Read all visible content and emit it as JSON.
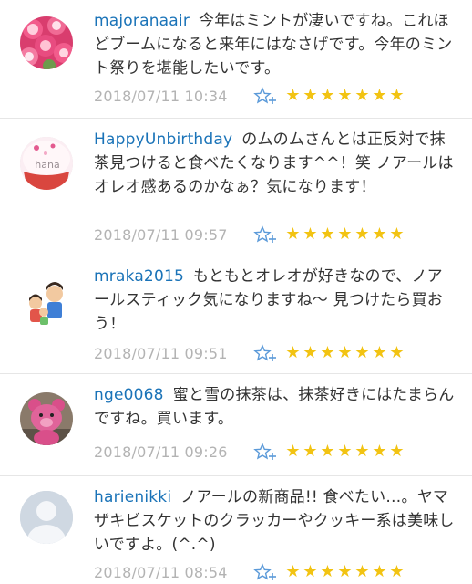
{
  "comments": [
    {
      "username": "majoranaair",
      "text": "今年はミントが凄いですね。これほどブームになると来年にはなさげです。今年のミント祭りを堪能したいです。",
      "timestamp": "2018/07/11 10:34",
      "avatar": "pink-roses",
      "favorite_icon": "star-plus-icon",
      "stars": [
        "★",
        "★",
        "★",
        "★",
        "★",
        "★",
        "★"
      ]
    },
    {
      "username": "HappyUnbirthday",
      "text": "のムのムさんとは正反対で抹茶見つけると食べたくなります^^！笑 ノアールはオレオ感あるのかなぁ？気になります！",
      "timestamp": "2018/07/11 09:57",
      "avatar": "cupcake-hana",
      "avatar_label": "hana",
      "favorite_icon": "star-plus-icon",
      "stars": [
        "★",
        "★",
        "★",
        "★",
        "★",
        "★",
        "★"
      ]
    },
    {
      "username": "mraka2015",
      "text": "もともとオレオが好きなので、ノアールスティック気になりますね〜 見つけたら買おう！",
      "timestamp": "2018/07/11 09:51",
      "avatar": "cartoon-family",
      "favorite_icon": "star-plus-icon",
      "stars": [
        "★",
        "★",
        "★",
        "★",
        "★",
        "★",
        "★"
      ]
    },
    {
      "username": "nge0068",
      "text": "蜜と雪の抹茶は、抹茶好きにはたまらんですね。買います。",
      "timestamp": "2018/07/11 09:26",
      "avatar": "pink-bear-toy",
      "favorite_icon": "star-plus-icon",
      "stars": [
        "★",
        "★",
        "★",
        "★",
        "★",
        "★",
        "★"
      ]
    },
    {
      "username": "harienikki",
      "text": "ノアールの新商品!! 食べたい…。ヤマザキビスケットのクラッカーやクッキー系は美味しいですよ。(^.^)",
      "timestamp": "2018/07/11 08:54",
      "avatar": "default-user",
      "favorite_icon": "star-plus-icon",
      "stars": [
        "★",
        "★",
        "★",
        "★",
        "★",
        "★",
        "★"
      ]
    }
  ]
}
